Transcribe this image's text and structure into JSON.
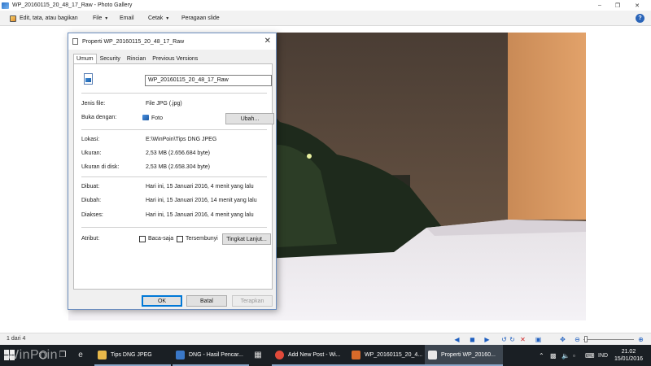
{
  "window": {
    "title": "WP_20160115_20_48_17_Raw - Photo Gallery"
  },
  "menu": {
    "edit": "Edit, tata, atau bagikan",
    "file": "File",
    "email": "Email",
    "print": "Cetak",
    "slideshow": "Peragaan slide"
  },
  "dialog": {
    "title": "Properti WP_20160115_20_48_17_Raw",
    "tabs": [
      "Umum",
      "Security",
      "Rincian",
      "Previous Versions"
    ],
    "filename": "WP_20160115_20_48_17_Raw",
    "labels": {
      "filetype": "Jenis file:",
      "openwith": "Buka dengan:",
      "location": "Lokasi:",
      "size": "Ukuran:",
      "sizeondisk": "Ukuran di disk:",
      "created": "Dibuat:",
      "modified": "Diubah:",
      "accessed": "Diakses:",
      "attributes": "Atribut:"
    },
    "values": {
      "filetype": "File JPG (.jpg)",
      "openwith": "Foto",
      "location": "E:\\WinPoin\\Tips DNG JPEG",
      "size": "2,53 MB (2.656.684 byte)",
      "sizeondisk": "2,53 MB (2.658.304 byte)",
      "created": "Hari ini, 15 Januari 2016, 4 menit yang lalu",
      "modified": "Hari ini, 15 Januari 2016, 14 menit yang lalu",
      "accessed": "Hari ini, 15 Januari 2016, 4 menit yang lalu"
    },
    "buttons": {
      "change": "Ubah...",
      "advanced": "Tingkat Lanjut...",
      "ok": "OK",
      "cancel": "Batal",
      "apply": "Terapkan"
    },
    "checkboxes": {
      "readonly": "Baca-saja",
      "hidden": "Tersembunyi"
    }
  },
  "nav": {
    "page_count": "1 dari 4"
  },
  "taskbar": {
    "watermark": "WinPoin",
    "tasks": [
      {
        "label": "Tips DNG JPEG",
        "color": "#e8b84a"
      },
      {
        "label": "DNG - Hasil Pencar...",
        "color": "#3a78c8"
      },
      {
        "label": "Add New Post - Wi...",
        "color": "#e04a3a"
      },
      {
        "label": "WP_20160115_20_4...",
        "color": "#d86a2a"
      },
      {
        "label": "Properti WP_20160...",
        "color": "#e8e8e8"
      }
    ],
    "lang": "IND",
    "time": "21.02",
    "date": "15/01/2016"
  }
}
